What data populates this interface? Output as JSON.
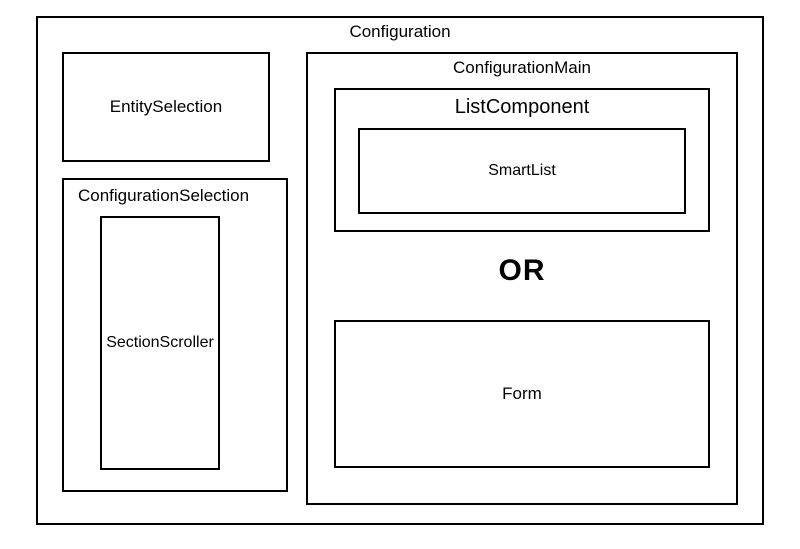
{
  "configuration": {
    "label": "Configuration",
    "left": {
      "entitySelection": {
        "label": "EntitySelection"
      },
      "configurationSelection": {
        "label": "ConfigurationSelection",
        "sectionScroller": {
          "label": "SectionScroller"
        }
      }
    },
    "main": {
      "label": "ConfigurationMain",
      "listComponent": {
        "label": "ListComponent",
        "smartList": {
          "label": "SmartList"
        }
      },
      "orLabel": "OR",
      "form": {
        "label": "Form"
      }
    }
  }
}
